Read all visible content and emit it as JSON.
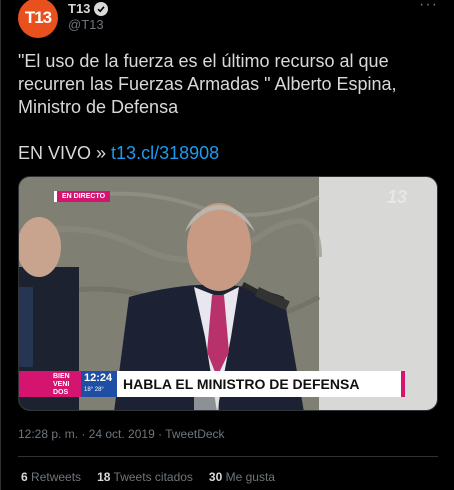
{
  "author": {
    "display_name": "T13",
    "handle": "@T13",
    "avatar_text": "T13",
    "avatar_color": "#e8501e",
    "verified_icon": "verified-badge-icon",
    "more_label": "···"
  },
  "tweet": {
    "text": "\"El uso de la fuerza es el último recurso al que recurren las Fuerzas Armadas \" Alberto Espina, Ministro de Defensa",
    "live_prefix": "EN VIVO » ",
    "link_text": "t13.cl/318908",
    "link_color": "#1d9bf0"
  },
  "media": {
    "live_badge": "EN DIRECTO",
    "channel_logo": "13",
    "lower_third": {
      "greeting": "BIEN VENI DOS",
      "clock": "12:24",
      "temperature": "18° 28°",
      "headline": "HABLA EL MINISTRO DE DEFENSA"
    },
    "accent_color": "#d4146f",
    "time_box_color": "#1e4fa5"
  },
  "meta": {
    "timestamp": "12:28 p. m. · 24 oct. 2019 · TweetDeck"
  },
  "stats": {
    "retweets_count": "6",
    "retweets_label": "Retweets",
    "quotes_count": "18",
    "quotes_label": "Tweets citados",
    "likes_count": "30",
    "likes_label": "Me gusta"
  }
}
